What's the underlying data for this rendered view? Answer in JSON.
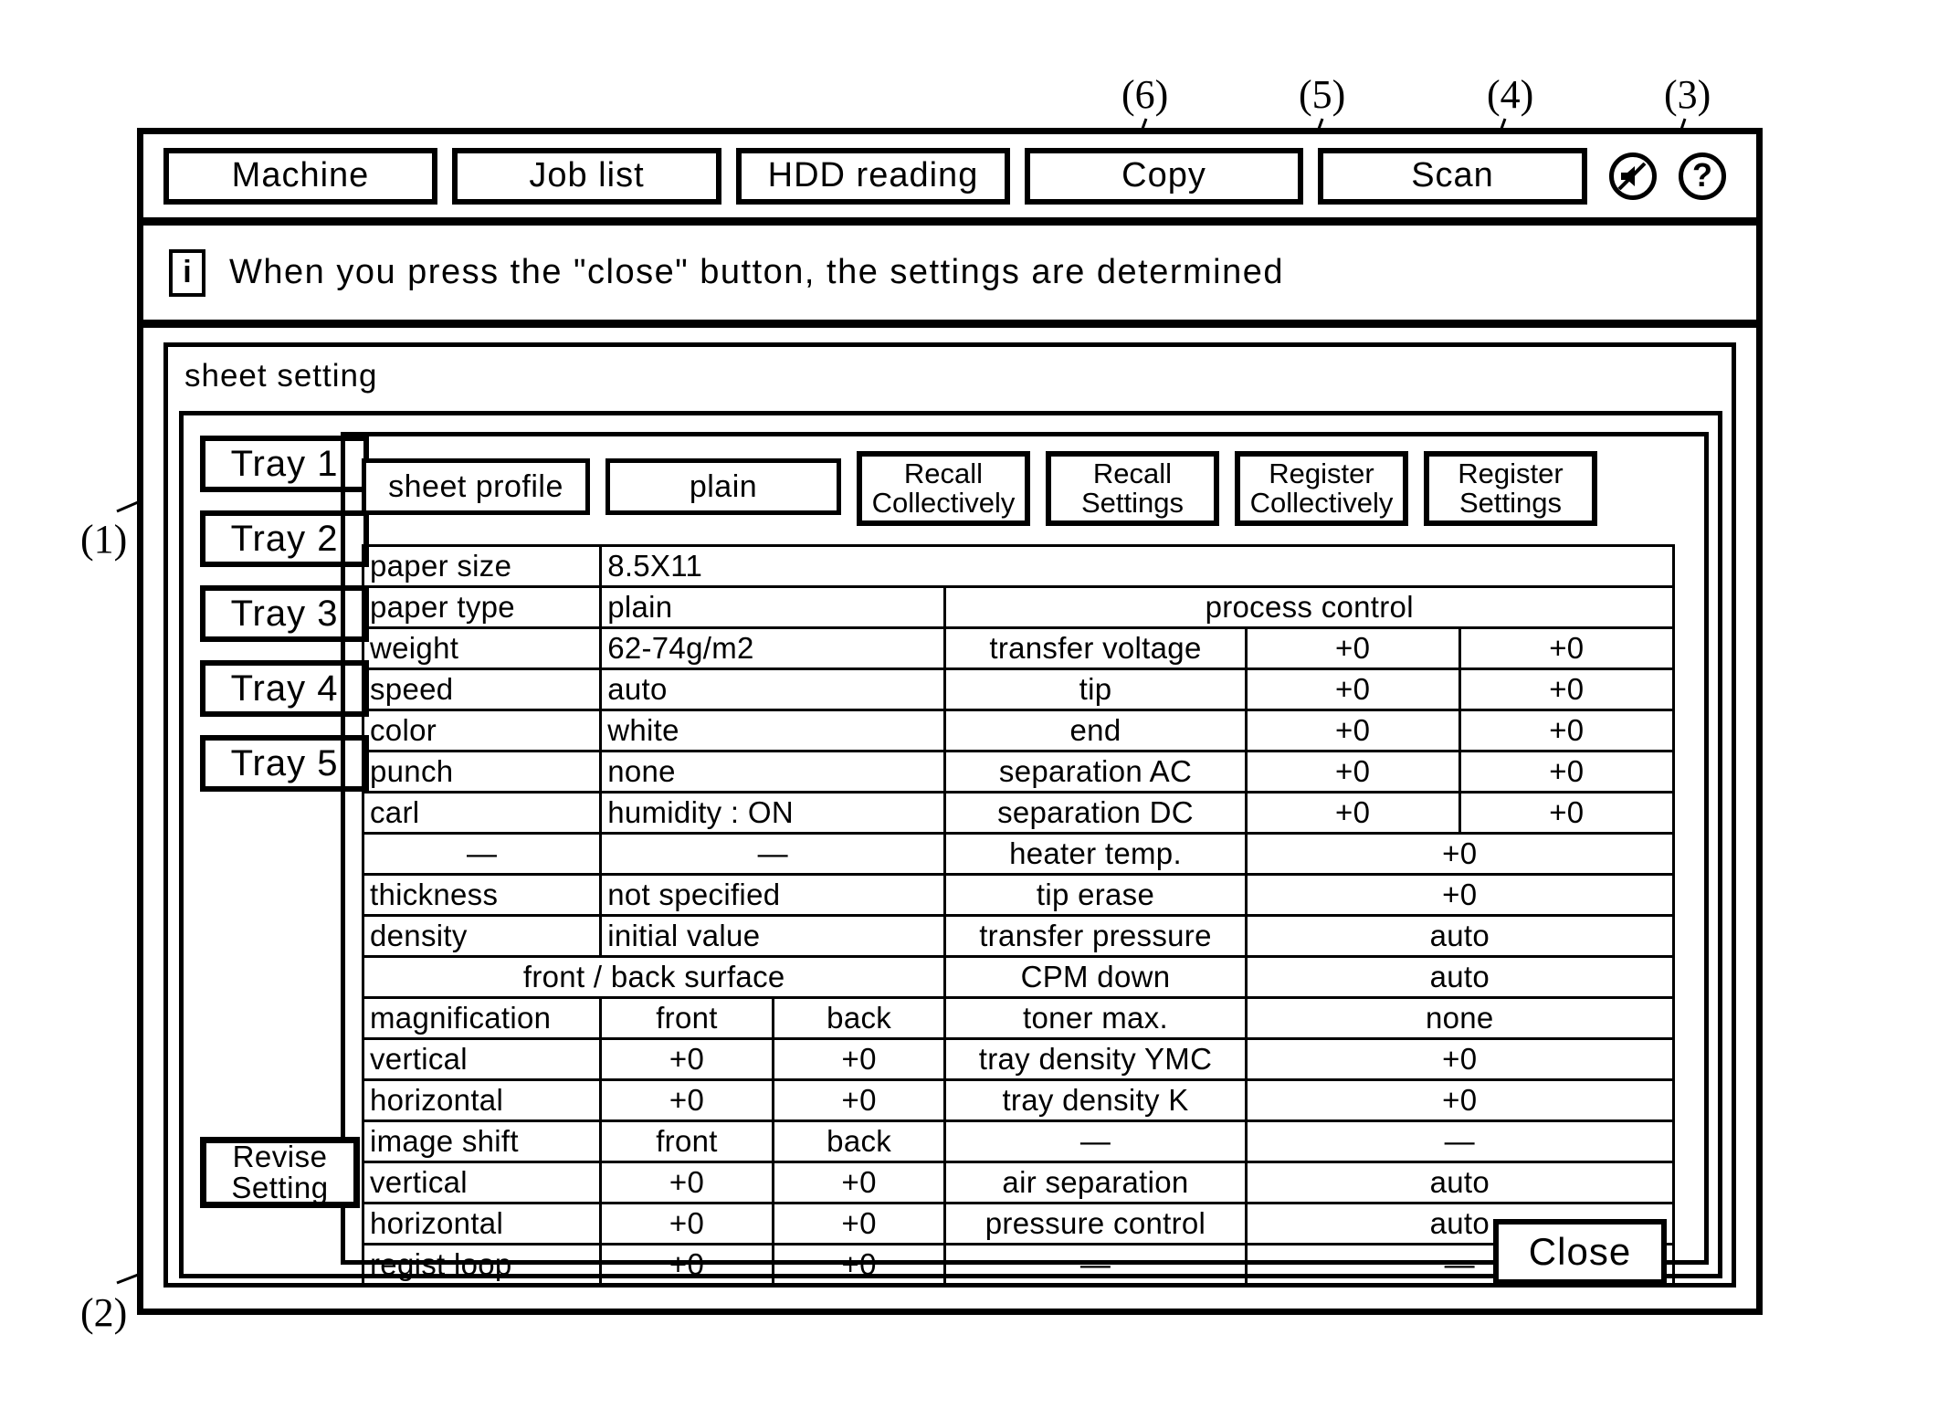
{
  "topnav": {
    "buttons": [
      {
        "label": "Machine",
        "name": "nav-machine"
      },
      {
        "label": "Job list",
        "name": "nav-joblist"
      },
      {
        "label": "HDD reading",
        "name": "nav-hdd"
      },
      {
        "label": "Copy",
        "name": "nav-copy"
      },
      {
        "label": "Scan",
        "name": "nav-scan"
      }
    ],
    "icons": [
      {
        "name": "sound-muted-icon"
      },
      {
        "name": "help-question-icon",
        "glyph": "?"
      }
    ]
  },
  "infobar": {
    "icon_glyph": "i",
    "message": "When you press the \"close\" button, the settings are determined"
  },
  "panel": {
    "title": "sheet setting"
  },
  "trays": [
    {
      "label": "Tray 1"
    },
    {
      "label": "Tray 2"
    },
    {
      "label": "Tray 3"
    },
    {
      "label": "Tray 4"
    },
    {
      "label": "Tray 5"
    }
  ],
  "toolbar": {
    "sheet_profile_label": "sheet profile",
    "sheet_profile_value": "plain",
    "recall_collectively_line1": "Recall",
    "recall_collectively_line2": "Collectively",
    "recall_settings_line1": "Recall",
    "recall_settings_line2": "Settings",
    "register_collectively_line1": "Register",
    "register_collectively_line2": "Collectively",
    "register_settings_line1": "Register",
    "register_settings_line2": "Settings"
  },
  "table": {
    "process_control_header": "process control",
    "front_back_surface_header": "front / back surface",
    "rows": {
      "paper_size_label": "paper size",
      "paper_size_value": "8.5X11",
      "paper_type_label": "paper type",
      "paper_type_value": "plain",
      "weight_label": "weight",
      "weight_value": "62-74g/m2",
      "transfer_voltage_label": "transfer voltage",
      "transfer_voltage_v1": "+0",
      "transfer_voltage_v2": "+0",
      "speed_label": "speed",
      "speed_value": "auto",
      "tip_label": "tip",
      "tip_v1": "+0",
      "tip_v2": "+0",
      "color_label": "color",
      "color_value": "white",
      "end_label": "end",
      "end_v1": "+0",
      "end_v2": "+0",
      "punch_label": "punch",
      "punch_value": "none",
      "separation_ac_label": "separation AC",
      "separation_ac_v1": "+0",
      "separation_ac_v2": "+0",
      "carl_label": "carl",
      "carl_value": "humidity : ON",
      "separation_dc_label": "separation DC",
      "separation_dc_v1": "+0",
      "separation_dc_v2": "+0",
      "heater_temp_label": "heater temp.",
      "heater_temp_value": "+0",
      "thickness_label": "thickness",
      "thickness_value": "not specified",
      "tip_erase_label": "tip erase",
      "tip_erase_value": "+0",
      "density_label": "density",
      "density_value": "initial value",
      "transfer_pressure_label": "transfer pressure",
      "transfer_pressure_value": "auto",
      "cpm_down_label": "CPM down",
      "cpm_down_value": "auto",
      "magnification_label": "magnification",
      "magnification_front": "front",
      "magnification_back": "back",
      "toner_max_label": "toner max.",
      "toner_max_value": "none",
      "mag_vertical_label": "vertical",
      "mag_vertical_front": "+0",
      "mag_vertical_back": "+0",
      "tray_density_ymc_label": "tray density YMC",
      "tray_density_ymc_value": "+0",
      "mag_horizontal_label": "horizontal",
      "mag_horizontal_front": "+0",
      "mag_horizontal_back": "+0",
      "tray_density_k_label": "tray density K",
      "tray_density_k_value": "+0",
      "image_shift_label": "image shift",
      "image_shift_front": "front",
      "image_shift_back": "back",
      "shift_vertical_label": "vertical",
      "shift_vertical_front": "+0",
      "shift_vertical_back": "+0",
      "air_separation_label": "air separation",
      "air_separation_value": "auto",
      "shift_horizontal_label": "horizontal",
      "shift_horizontal_front": "+0",
      "shift_horizontal_back": "+0",
      "pressure_control_label": "pressure control",
      "pressure_control_value": "auto",
      "regist_loop_label": "regist loop",
      "regist_loop_front": "+0",
      "regist_loop_back": "+0"
    }
  },
  "revise": {
    "line1": "Revise",
    "line2": "Setting"
  },
  "close": {
    "label": "Close"
  },
  "callouts": {
    "c1": "(1)",
    "c2": "(2)",
    "c3": "(3)",
    "c4": "(4)",
    "c5": "(5)",
    "c6": "(6)"
  }
}
